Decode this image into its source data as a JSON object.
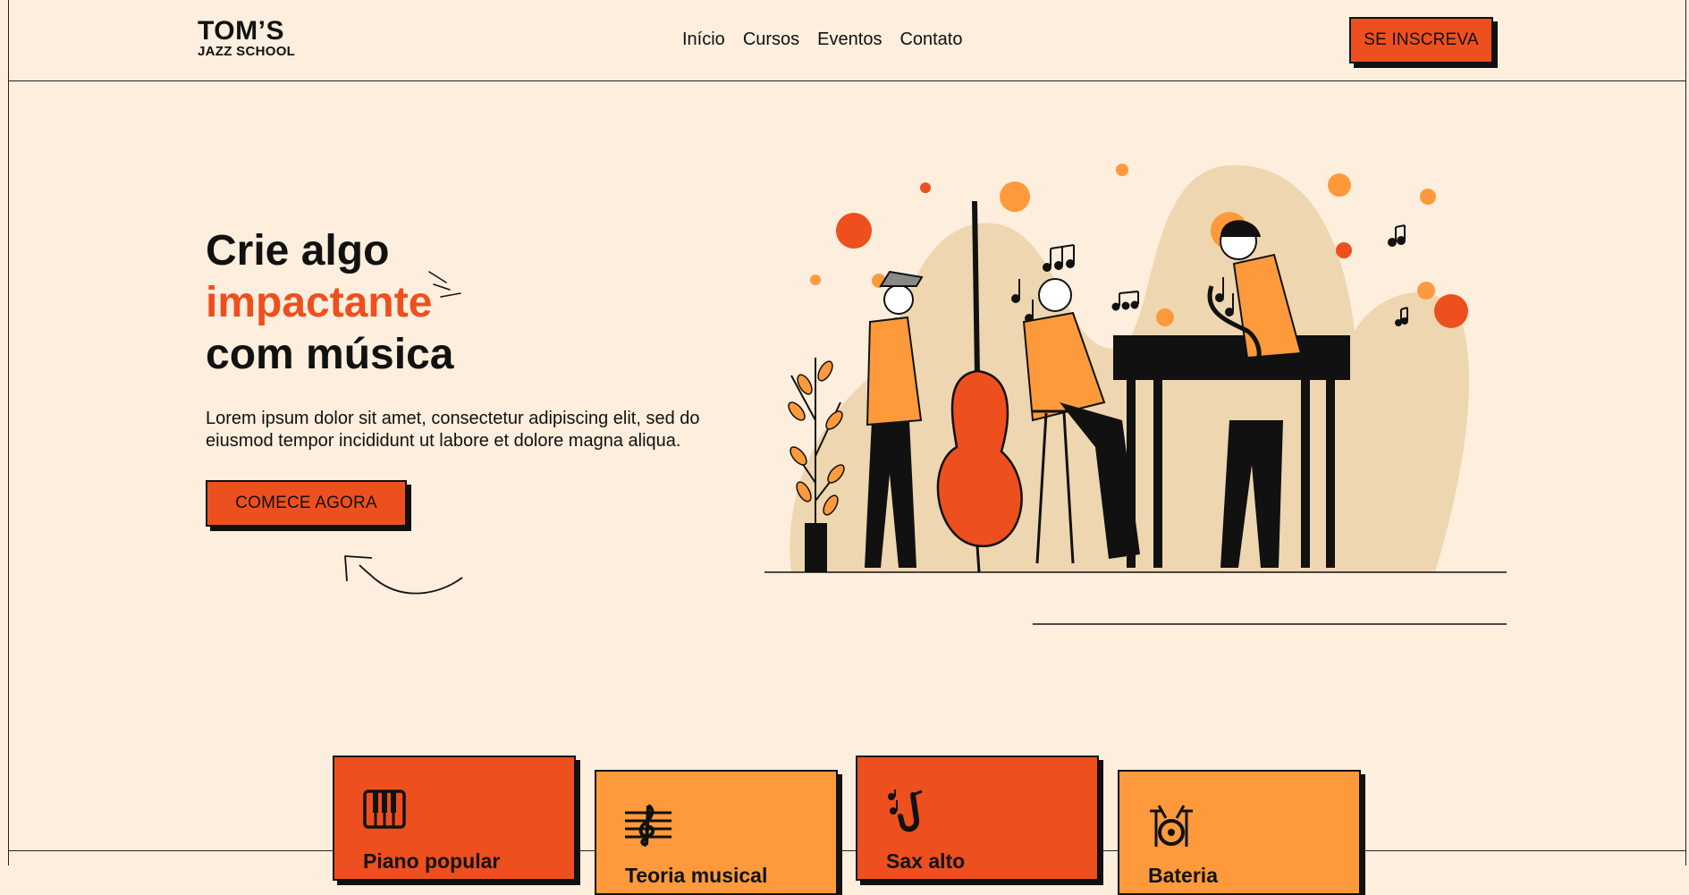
{
  "logo": {
    "line1": "TOM’S",
    "line2": "JAZZ SCHOOL"
  },
  "nav": {
    "items": [
      "Início",
      "Cursos",
      "Eventos",
      "Contato"
    ]
  },
  "header": {
    "signup_label": "SE INSCREVA"
  },
  "hero": {
    "title_line1": "Crie algo",
    "title_line2": "impactante",
    "title_line3": "com música",
    "description": "Lorem ipsum dolor sit amet, consectetur adipiscing elit, sed do eiusmod tempor incididunt ut labore et dolore magna aliqua.",
    "cta_label": "COMECE AGORA"
  },
  "courses": [
    {
      "title": "Piano popular",
      "icon": "piano-keys-icon"
    },
    {
      "title": "Teoria musical",
      "icon": "treble-clef-icon"
    },
    {
      "title": "Sax alto",
      "icon": "saxophone-icon"
    },
    {
      "title": "Bateria",
      "icon": "drum-kit-icon"
    }
  ],
  "colors": {
    "background": "#fdeedd",
    "accent": "#ee4f1e",
    "accent_light": "#fe9a3c",
    "ink": "#111111",
    "blob": "#eed6b0"
  }
}
